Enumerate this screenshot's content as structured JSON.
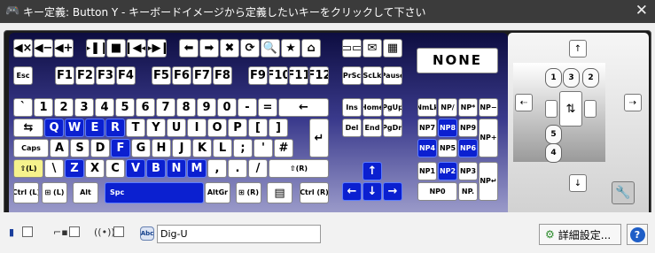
{
  "window": {
    "title": "キー定義: Button Y - キーボードイメージから定義したいキーをクリックして下さい",
    "icon": "gamepad-icon",
    "close_glyph": "✕"
  },
  "keys": {
    "media": [
      "◀×",
      "◀−",
      "◀+",
      "▶❚❚",
      "■",
      "❚◀◀",
      "▶▶❚",
      "⬅",
      "➡",
      "✖",
      "⟳",
      "🔍",
      "★",
      "⌂",
      "▭▭",
      "✉",
      "▦"
    ],
    "none": "NONE",
    "fn": [
      "Esc",
      "F1",
      "F2",
      "F3",
      "F4",
      "F5",
      "F6",
      "F7",
      "F8",
      "F9",
      "F10",
      "F11",
      "F12",
      "PrSc",
      "ScLk",
      "Pause"
    ],
    "row1": [
      "`",
      "1",
      "2",
      "3",
      "4",
      "5",
      "6",
      "7",
      "8",
      "9",
      "0",
      "-",
      "=",
      "←"
    ],
    "row2": [
      "⇆",
      "Q",
      "W",
      "E",
      "R",
      "T",
      "Y",
      "U",
      "I",
      "O",
      "P",
      "[",
      "]",
      "↵"
    ],
    "row3": [
      "Caps",
      "A",
      "S",
      "D",
      "F",
      "G",
      "H",
      "J",
      "K",
      "L",
      ";",
      "'",
      "#"
    ],
    "row4": [
      "⇧(L)",
      "\\",
      "Z",
      "X",
      "C",
      "V",
      "B",
      "N",
      "M",
      ",",
      ".",
      "/",
      "⇧(R)"
    ],
    "row5": [
      "Ctrl (L)",
      "⊞ (L)",
      "Alt",
      "Spc",
      "AltGr",
      "⊞ (R)",
      "▤",
      "Ctrl (R)"
    ],
    "nav": [
      "Ins",
      "Home",
      "PgUp",
      "Del",
      "End",
      "PgDn"
    ],
    "arrows": [
      "↑",
      "←",
      "↓",
      "→"
    ],
    "numpad": [
      "NmLk",
      "NP/",
      "NP*",
      "NP−",
      "NP7",
      "NP8",
      "NP9",
      "NP+",
      "NP4",
      "NP5",
      "NP6",
      "NP1",
      "NP2",
      "NP3",
      "NP↵",
      "NP0",
      "NP."
    ]
  },
  "mouse": {
    "up": "↑",
    "down": "↓",
    "left": "⇠",
    "right": "⇢",
    "buttons": [
      "1",
      "3",
      "2",
      "4",
      "5"
    ],
    "wheel": "⇅",
    "settings_icon": "wrench-icon"
  },
  "bottom": {
    "name_value": "Dig-U",
    "name_icon_label": "Abc",
    "advanced_label": "詳細設定...",
    "help_label": "?"
  },
  "colors": {
    "selected": "#0b20d0",
    "shift_highlight": "#f6f28c",
    "title_bar": "#3b3b3b"
  }
}
